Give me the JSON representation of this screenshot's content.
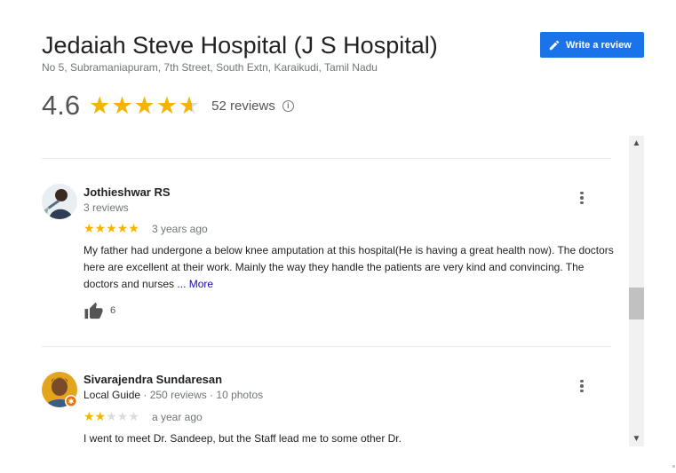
{
  "place": {
    "name": "Jedaiah Steve Hospital (J S Hospital)",
    "address": "No 5, Subramaniapuram, 7th Street, South Extn, Karaikudi, Tamil Nadu",
    "rating": "4.6",
    "rating_value": 4.6,
    "reviews_label": "52 reviews"
  },
  "write_review": {
    "label": "Write a review",
    "icon": "pencil-icon"
  },
  "colors": {
    "accent": "#1a73e8",
    "star": "#f5b400",
    "star_off": "#dadce0",
    "link": "#1a0dab"
  },
  "reviews": [
    {
      "name": "Jothieshwar RS",
      "meta": "3 reviews",
      "stars": 5,
      "stars_text": "★★★★★",
      "time": "3 years ago",
      "text": "My father had undergone a below knee amputation at this hospital(He is having a great health now). The doctors here are excellent at their work. Mainly the way they handle the patients are very kind and convincing. The doctors and nurses",
      "more_label": "... More",
      "likes": "6"
    },
    {
      "name": "Sivarajendra Sundaresan",
      "local_guide": "Local Guide",
      "meta": " · 250 reviews · 10 photos",
      "stars": 2,
      "stars_on": "★★",
      "stars_off": "★★★",
      "time": "a year ago",
      "text": "I went to meet Dr. Sandeep, but the Staff lead me to some other Dr."
    }
  ],
  "scrollbar": {
    "up_icon": "chevron-up-icon",
    "down_icon": "chevron-down-icon"
  }
}
